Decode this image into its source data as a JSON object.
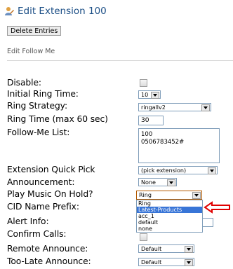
{
  "header": {
    "title": "Edit Extension 100",
    "icon": "user-edit-icon"
  },
  "delete_button": "Delete Entries",
  "section_title": "Edit Follow Me",
  "fields": {
    "disable": {
      "label": "Disable:"
    },
    "initial_ring_time": {
      "label": "Initial Ring Time:",
      "value": "10"
    },
    "ring_strategy": {
      "label": "Ring Strategy:",
      "value": "ringallv2"
    },
    "ring_time": {
      "label": "Ring Time (max 60 sec)",
      "value": "30"
    },
    "follow_me_list": {
      "label": "Follow-Me List:",
      "value": "100\n0506783452#"
    },
    "ext_quick_pick": {
      "label": "Extension Quick Pick",
      "value": "(pick extension)"
    },
    "announcement": {
      "label": "Announcement:",
      "value": "None"
    },
    "play_music_on_hold": {
      "label": "Play Music On Hold?",
      "value": "Ring"
    },
    "cid_name_prefix": {
      "label": "CID Name Prefix:"
    },
    "alert_info": {
      "label": "Alert Info:"
    },
    "confirm_calls": {
      "label": "Confirm Calls:"
    },
    "remote_announce": {
      "label": "Remote Announce:",
      "value": "Default"
    },
    "too_late_announce": {
      "label": "Too-Late Announce:",
      "value": "Default"
    }
  },
  "moh_options": [
    {
      "label": "Ring",
      "selected": false
    },
    {
      "label": "Latest-Products",
      "selected": true
    },
    {
      "label": "acc_1",
      "selected": false
    },
    {
      "label": "default",
      "selected": false
    },
    {
      "label": "none",
      "selected": false
    }
  ],
  "colors": {
    "title": "#1c4f86",
    "annotation_arrow": "#e00000",
    "highlight": "#3875d7"
  }
}
